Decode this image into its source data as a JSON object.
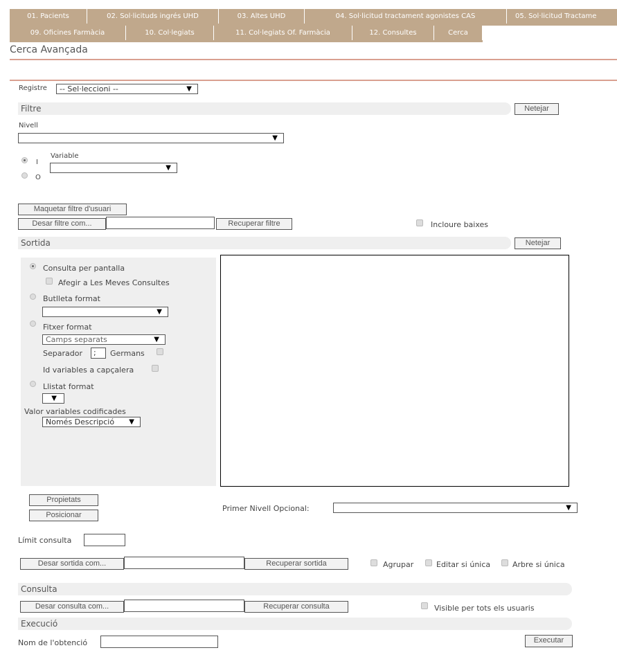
{
  "tabs": {
    "row1": [
      "01. Pacients",
      "02. Sol·licituds ingrés UHD",
      "03. Altes UHD",
      "04. Sol·licitud tractament agonistes CAS",
      "05. Sol·licitud Tractame"
    ],
    "row2": [
      "09. Oficines Farmàcia",
      "10. Col·legiats",
      "11. Col·legiats Of. Farmàcia",
      "12. Consultes",
      "Cerca"
    ]
  },
  "page_title": "Cerca Avançada",
  "registre": {
    "label": "Registre",
    "value": "-- Sel·leccioni --"
  },
  "filtre": {
    "title": "Filtre",
    "clear": "Netejar",
    "nivell": "Nivell",
    "logic_and": "I",
    "logic_or": "O",
    "variable": "Variable",
    "maquetar": "Maquetar filtre d'usuari",
    "desar": "Desar filtre com...",
    "recuperar": "Recuperar filtre",
    "incloure": "Incloure baixes"
  },
  "sortida": {
    "title": "Sortida",
    "clear": "Netejar",
    "consulta_pantalla": "Consulta per pantalla",
    "afegir": "Afegir a Les Meves Consultes",
    "butlleta": "Butlleta format",
    "fitxer": "Fitxer format",
    "camps": "Camps separats",
    "separador": "Separador",
    "separador_value": ";",
    "germans": "Germans",
    "id_vars": "Id variables a capçalera",
    "llistat": "Llistat format",
    "valor_vars": "Valor variables codificades",
    "nomes": "Només Descripció",
    "propietats": "Propietats",
    "posicionar": "Posicionar",
    "primer_nivell": "Primer Nivell Opcional:",
    "limit": "Límit consulta",
    "desar": "Desar sortida com...",
    "recuperar": "Recuperar sortida",
    "agrupar": "Agrupar",
    "editar": "Editar si única",
    "arbre": "Arbre si única"
  },
  "consulta": {
    "title": "Consulta",
    "desar": "Desar consulta com...",
    "recuperar": "Recuperar consulta",
    "visible": "Visible per tots els usuaris"
  },
  "execucio": {
    "title": "Execució",
    "nom": "Nom de l'obtenció",
    "executar": "Executar"
  },
  "colors": {
    "tab_bg": "#c0a88c",
    "accent_line": "#d9a090",
    "section_bg": "#efefef"
  },
  "icons": {
    "dropdown": "dropdown-arrow-icon"
  }
}
